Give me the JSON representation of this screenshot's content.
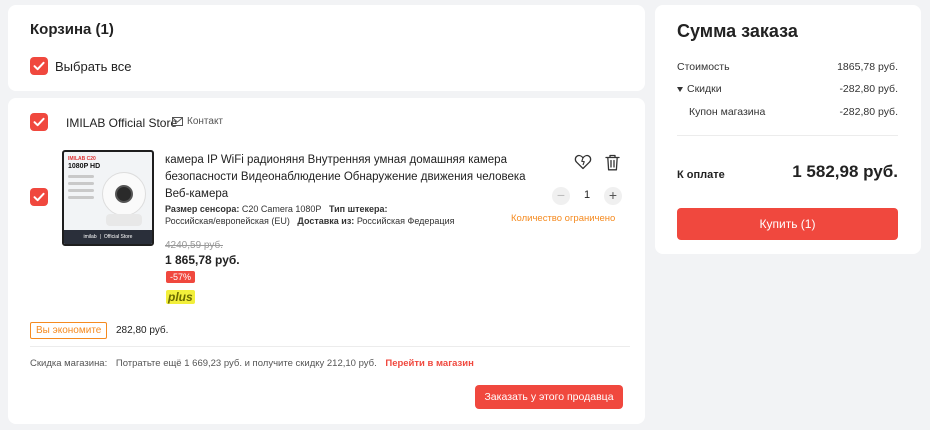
{
  "cart": {
    "title": "Корзина (1)",
    "select_all_label": "Выбрать все"
  },
  "store": {
    "name": "IMILAB Official Store",
    "contact_label": "Контакт",
    "item": {
      "image_text": {
        "logo": "IMILAB C20",
        "resolution": "1080P HD",
        "band_brand": "imilab",
        "band_store": "Official Store"
      },
      "title": "камера IP WiFi радионяня Внутренняя умная домашняя камера безопасности Видеонаблюдение Обнаружение движения человека Веб-камера",
      "attributes": [
        {
          "label": "Размер сенсора:",
          "value": "C20 Camera 1080P"
        },
        {
          "label": "Тип штекера:",
          "value": "Российская/европейская (EU)"
        },
        {
          "label": "Доставка из:",
          "value": "Российская Федерация"
        }
      ],
      "old_price": "4240,59 руб.",
      "price": "1 865,78 руб.",
      "discount": "-57%",
      "plus_label": "plus",
      "quantity": "1",
      "quantity_note": "Количество ограничено"
    },
    "savings_badge": "Вы экономите",
    "savings_value": "282,80 руб.",
    "promo": {
      "label": "Скидка магазина:",
      "text": "Потратьте ещё 1 669,23 руб. и получите скидку 212,10 руб.",
      "link": "Перейти в магазин"
    },
    "order_button": "Заказать у этого продавца"
  },
  "summary": {
    "title": "Сумма заказа",
    "rows": [
      {
        "label": "Стоимость",
        "value": "1865,78 руб."
      },
      {
        "label": "Скидки",
        "value": "-282,80 руб."
      },
      {
        "label": "Купон магазина",
        "value": "-282,80 руб."
      }
    ],
    "total_label": "К оплате",
    "total_value": "1 582,98 руб.",
    "buy_button": "Купить (1)"
  },
  "colors": {
    "accent": "#f0483e",
    "warning": "#f58a1f"
  }
}
